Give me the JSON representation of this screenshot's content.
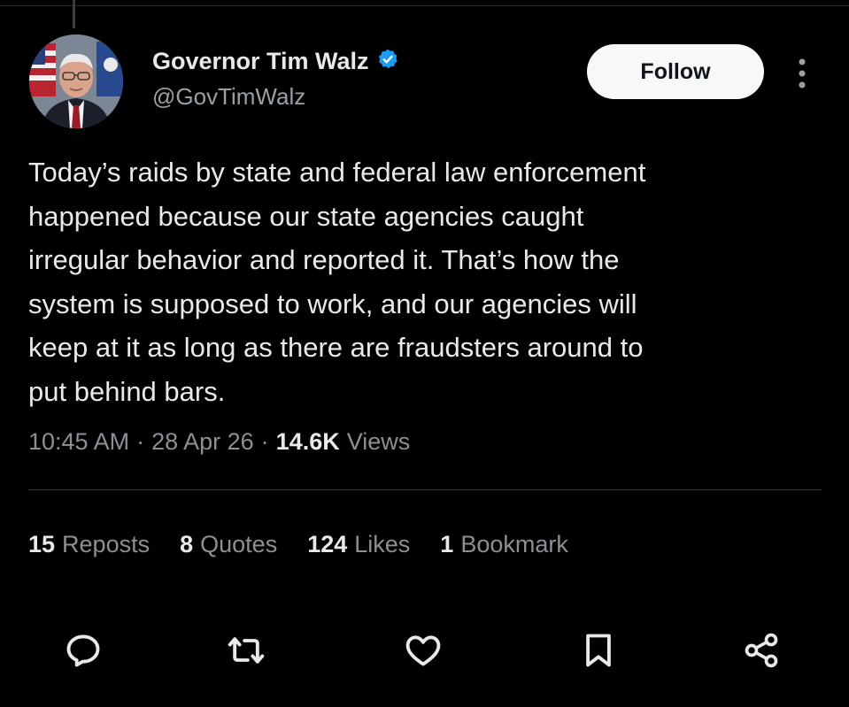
{
  "author": {
    "name": "Governor Tim Walz",
    "handle": "@GovTimWalz",
    "verified_color": "#1d9bf0"
  },
  "follow_label": "Follow",
  "tweet_text": "Today’s raids by state and federal law enforcement\nhappened because our state agencies caught\nirregular behavior and reported it. That’s how the\nsystem is supposed to work, and our agencies will\nkeep at it as long as there are fraudsters around to\nput behind bars.",
  "meta": {
    "time": "10:45 AM",
    "date": "28 Apr 26",
    "views_count": "14.6K",
    "views_label": "Views"
  },
  "stats": [
    {
      "count": "15",
      "label": "Reposts"
    },
    {
      "count": "8",
      "label": "Quotes"
    },
    {
      "count": "124",
      "label": "Likes"
    },
    {
      "count": "1",
      "label": "Bookmark"
    }
  ],
  "actions": [
    "reply-icon",
    "repost-icon",
    "like-icon",
    "bookmark-icon",
    "share-icon"
  ],
  "colors": {
    "background": "#000000",
    "text": "#e7e9ea",
    "secondary": "#8b9096",
    "button_bg": "#f7f9f9"
  }
}
